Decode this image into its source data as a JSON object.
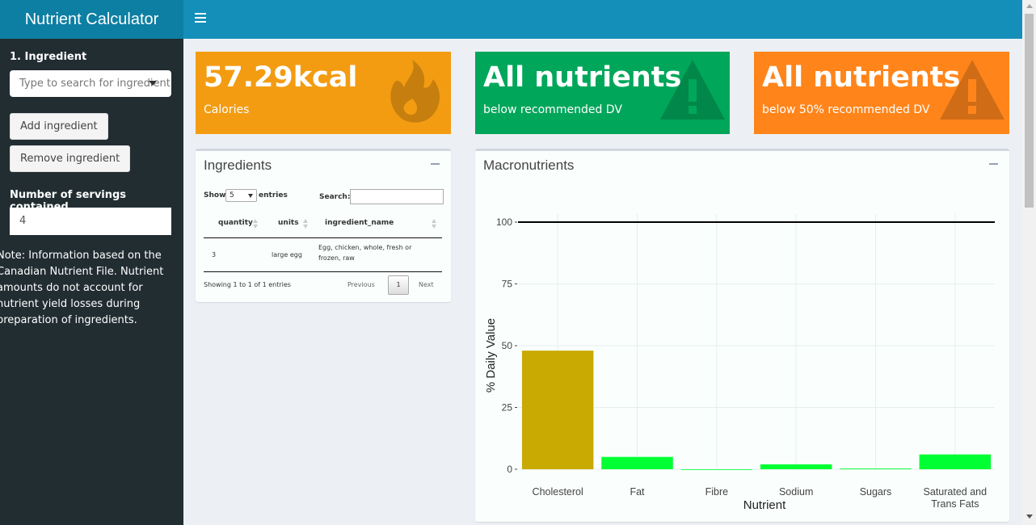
{
  "header": {
    "app_title": "Nutrient Calculator",
    "menu_icon": "hamburger-icon"
  },
  "sidebar": {
    "ingredient_label": "1. Ingredient",
    "ingredient_placeholder": "Type to search for ingredient",
    "add_button": "Add ingredient",
    "remove_button": "Remove ingredient",
    "servings_label": "Number of servings contained",
    "servings_value": "4",
    "note": "Note: Information based on the Canadian Nutrient File. Nutrient amounts do not account for nutrient yield losses during preparation of ingredients."
  },
  "value_boxes": [
    {
      "value": "57.29kcal",
      "subtitle": "Calories",
      "icon": "fire-icon",
      "color": "#f39c12"
    },
    {
      "value": "All nutrients",
      "subtitle": "below recommended DV",
      "icon": "warning-icon",
      "color": "#00a65a"
    },
    {
      "value": "All nutrients",
      "subtitle": "below 50% recommended DV",
      "icon": "warning-icon",
      "color": "#ff851b"
    }
  ],
  "ingredients_panel": {
    "title": "Ingredients",
    "show_label": "Show",
    "length_value": "5",
    "entries_label": "entries",
    "search_label": "Search:",
    "columns": [
      "quantity",
      "units",
      "ingredient_name"
    ],
    "rows": [
      {
        "quantity": "3",
        "units": "large egg",
        "ingredient_name": "Egg, chicken, whole, fresh or frozen, raw"
      }
    ],
    "info": "Showing 1 to 1 of 1 entries",
    "previous": "Previous",
    "page": "1",
    "next": "Next"
  },
  "macros_panel": {
    "title": "Macronutrients"
  },
  "chart_data": {
    "type": "bar",
    "title": "",
    "xlabel": "Nutrient",
    "ylabel": "% Daily Value",
    "categories": [
      "Cholesterol",
      "Fat",
      "Fibre",
      "Sodium",
      "Sugars",
      "Saturated and Trans Fats"
    ],
    "values": [
      48,
      5,
      0,
      2,
      0.3,
      6
    ],
    "bar_colors": [
      "#c9aa03",
      "#00ff33",
      "#00ff33",
      "#00ff33",
      "#00ff33",
      "#00ff33"
    ],
    "reference_line": 100,
    "yticks": [
      "0",
      "25",
      "50",
      "75",
      "100"
    ],
    "ylim": [
      0,
      100
    ],
    "grid": true
  }
}
